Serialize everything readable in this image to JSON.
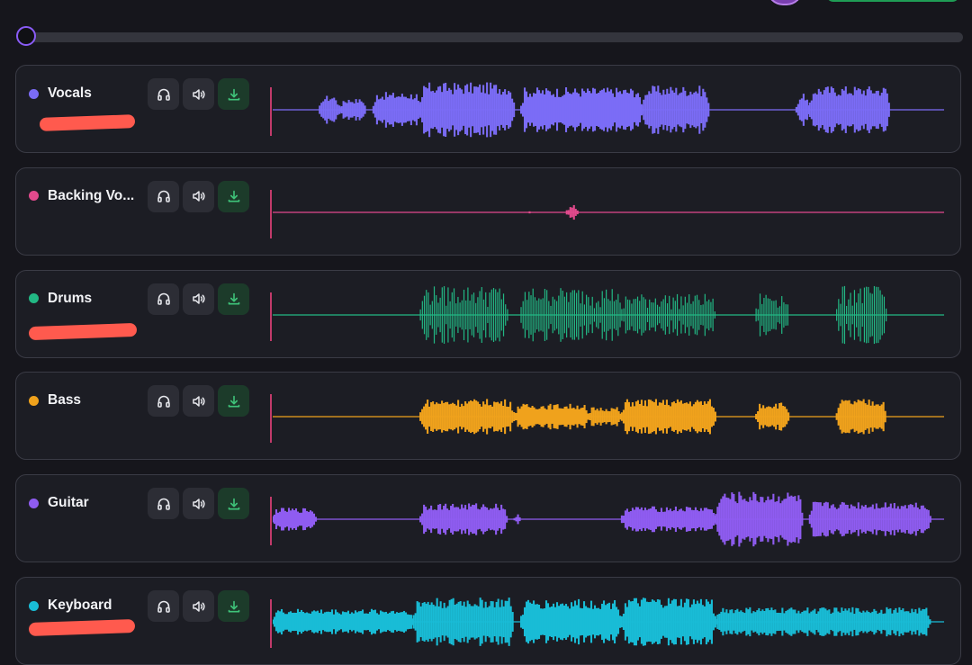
{
  "header": {
    "avatar_color": "#7a3fb0",
    "button_color": "#1f9d55"
  },
  "seek": {
    "position": 0.0,
    "accent": "#8a5cf6"
  },
  "buttons": {
    "solo_icon": "headphones-icon",
    "mute_icon": "speaker-icon",
    "download_icon": "download-icon"
  },
  "tracks": [
    {
      "name": "Vocals",
      "color": "#7b6cf6",
      "redacted": true,
      "segments": [
        [
          0.07,
          0.1,
          0.45
        ],
        [
          0.1,
          0.14,
          0.35
        ],
        [
          0.15,
          0.22,
          0.55
        ],
        [
          0.22,
          0.36,
          0.85
        ],
        [
          0.37,
          0.55,
          0.7
        ],
        [
          0.55,
          0.65,
          0.75
        ],
        [
          0.78,
          0.8,
          0.5
        ],
        [
          0.8,
          0.92,
          0.75
        ]
      ]
    },
    {
      "name": "Backing Vo...",
      "color": "#e24a8d",
      "redacted": false,
      "segments": [
        [
          0.38,
          0.385,
          0.08
        ],
        [
          0.438,
          0.455,
          0.25
        ]
      ]
    },
    {
      "name": "Drums",
      "color": "#22b884",
      "redacted": true,
      "segments": [
        [
          0.22,
          0.35,
          0.9
        ],
        [
          0.37,
          0.52,
          0.85
        ],
        [
          0.52,
          0.66,
          0.65
        ],
        [
          0.72,
          0.77,
          0.7
        ],
        [
          0.84,
          0.915,
          0.9
        ]
      ],
      "spiky": true
    },
    {
      "name": "Bass",
      "color": "#f0a21c",
      "redacted": false,
      "segments": [
        [
          0.22,
          0.36,
          0.55
        ],
        [
          0.36,
          0.47,
          0.4
        ],
        [
          0.47,
          0.52,
          0.3
        ],
        [
          0.52,
          0.66,
          0.55
        ],
        [
          0.72,
          0.77,
          0.45
        ],
        [
          0.84,
          0.915,
          0.55
        ]
      ]
    },
    {
      "name": "Guitar",
      "color": "#8f5cf1",
      "redacted": false,
      "segments": [
        [
          0.0,
          0.065,
          0.35
        ],
        [
          0.22,
          0.35,
          0.5
        ],
        [
          0.36,
          0.37,
          0.18
        ],
        [
          0.52,
          0.66,
          0.4
        ],
        [
          0.66,
          0.79,
          0.85
        ],
        [
          0.8,
          0.98,
          0.55
        ]
      ]
    },
    {
      "name": "Keyboard",
      "color": "#19bcd6",
      "redacted": true,
      "segments": [
        [
          0.0,
          0.21,
          0.4
        ],
        [
          0.21,
          0.36,
          0.75
        ],
        [
          0.37,
          0.52,
          0.7
        ],
        [
          0.52,
          0.66,
          0.75
        ],
        [
          0.66,
          0.98,
          0.45
        ]
      ]
    }
  ]
}
